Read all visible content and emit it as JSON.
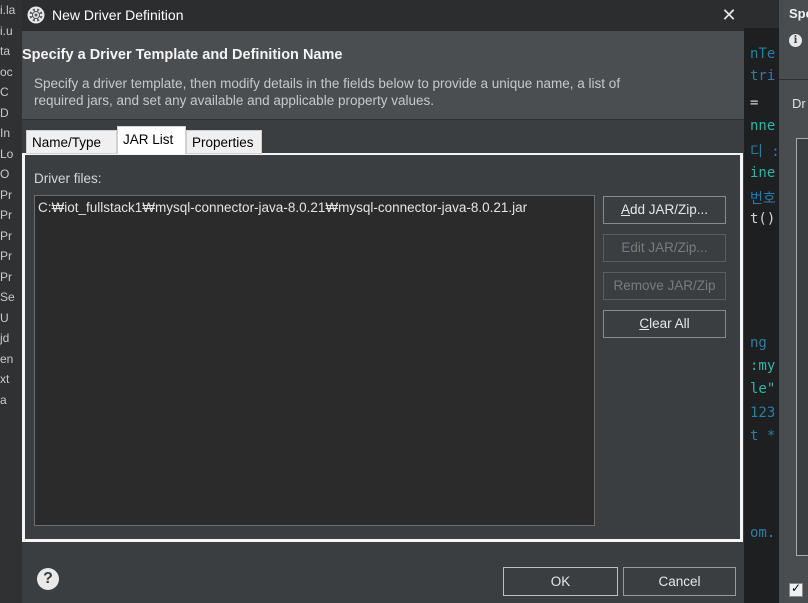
{
  "background": {
    "left_items": [
      "i.la",
      "i.u",
      "ta",
      "oc",
      "C",
      "D",
      "In",
      "Lo",
      "O",
      "Pr",
      "Pr",
      "Pr",
      "Pr",
      "Pr",
      "Se",
      "U",
      "jd",
      "en",
      "xt",
      "a"
    ],
    "code_lines": [
      {
        "text": "nTe",
        "color": "#2c7ea6"
      },
      {
        "text": "tri",
        "color": "#2c7ea6"
      },
      {
        "text": "=",
        "color": "#d4d4d4"
      },
      {
        "text": "nne",
        "color": "#2fb5a9"
      },
      {
        "text": "디 :",
        "color": "#2c7ea6"
      },
      {
        "text": "ine",
        "color": "#2fb5a9"
      },
      {
        "text": "번호",
        "color": "#2c7ea6"
      },
      {
        "text": "t()",
        "color": "#d4d4d4"
      },
      {
        "text": "ng",
        "color": "#2c7ea6"
      },
      {
        "text": ":my",
        "color": "#2fb5a9"
      },
      {
        "text": "le\"",
        "color": "#2fb5a9"
      },
      {
        "text": "123",
        "color": "#2c7ea6"
      },
      {
        "text": "t *",
        "color": "#2c7ea6"
      },
      {
        "text": "om.",
        "color": "#2c7ea6"
      }
    ],
    "right_dialog": {
      "title": "Spe",
      "info_icon": "i",
      "label": "Dr"
    }
  },
  "dialog": {
    "title": "New Driver Definition",
    "close_glyph": "✕",
    "header_title": "Specify a Driver Template and Definition Name",
    "header_desc": "Specify a driver template, then modify details in the fields below to provide a unique name, a list of required jars, and set any available and applicable property values.",
    "tabs": [
      {
        "label": "Name/Type",
        "selected": false
      },
      {
        "label": "JAR List",
        "selected": true
      },
      {
        "label": "Properties",
        "selected": false
      }
    ],
    "driver_files_label": "Driver files:",
    "jar_items": [
      "C:₩iot_fullstack1₩mysql-connector-java-8.0.21₩mysql-connector-java-8.0.21.jar"
    ],
    "buttons": {
      "add_mnemonic": "A",
      "add_rest": "dd JAR/Zip...",
      "edit": "Edit JAR/Zip...",
      "remove": "Remove JAR/Zip",
      "clear_mnemonic": "C",
      "clear_rest": "lear All"
    },
    "help_glyph": "?",
    "ok_label": "OK",
    "cancel_label": "Cancel"
  }
}
